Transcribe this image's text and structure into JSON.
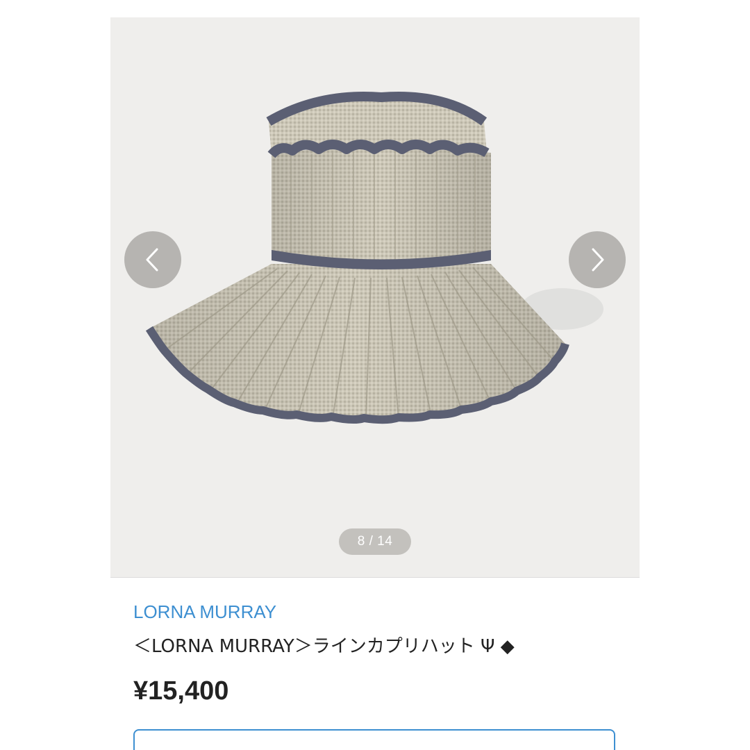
{
  "gallery": {
    "image_alt": "",
    "counter": "8 / 14",
    "prev_glyph": "<",
    "next_glyph": ">"
  },
  "product": {
    "brand": "LORNA MURRAY",
    "title": "＜LORNA MURRAY＞ラインカプリハット Ψ ◆",
    "price": "¥15,400"
  },
  "colors": {
    "brand_link": "#3d8fd1",
    "gallery_bg": "#efeeec",
    "hat_trim": "#5b5f73",
    "hat_straw": "#c9c4b4"
  },
  "icons": {
    "search": "search-icon",
    "prev": "chevron-left-icon",
    "next": "chevron-right-icon"
  }
}
